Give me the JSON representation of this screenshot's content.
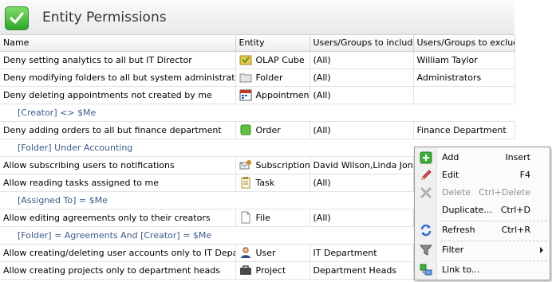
{
  "header": {
    "title": "Entity Permissions"
  },
  "columns": [
    "Name",
    "Entity",
    "Users/Groups to include",
    "Users/Groups to exclude"
  ],
  "rows": [
    {
      "type": "rule",
      "name": "Deny setting analytics to all but IT Director",
      "entity": "OLAP Cube",
      "icon": "olap-cube-icon",
      "include": "(All)",
      "exclude": "William Taylor"
    },
    {
      "type": "rule",
      "name": "Deny modifying folders to all but system administrators",
      "entity": "Folder",
      "icon": "folder-icon",
      "include": "(All)",
      "exclude": "Administrators"
    },
    {
      "type": "rule",
      "name": "Deny deleting appointments not created by me",
      "entity": "Appointment",
      "icon": "appointment-icon",
      "include": "(All)",
      "exclude": ""
    },
    {
      "type": "criteria",
      "text": "[Creator] <> $Me"
    },
    {
      "type": "rule",
      "name": "Deny adding orders to all but finance department",
      "entity": "Order",
      "icon": "order-icon",
      "include": "(All)",
      "exclude": "Finance Department"
    },
    {
      "type": "criteria",
      "text": "[Folder] Under Accounting"
    },
    {
      "type": "rule",
      "name": "Allow subscribing users to notifications",
      "entity": "Subscription",
      "icon": "subscription-icon",
      "include": "David Wilson,Linda Jones",
      "exclude": ""
    },
    {
      "type": "rule",
      "name": "Allow reading tasks assigned to me",
      "entity": "Task",
      "icon": "task-icon",
      "include": "(All)",
      "exclude": ""
    },
    {
      "type": "criteria",
      "text": "[Assigned To] = $Me"
    },
    {
      "type": "rule",
      "name": "Allow editing agreements only to their creators",
      "entity": "File",
      "icon": "file-icon",
      "include": "(All)",
      "exclude": ""
    },
    {
      "type": "criteria",
      "text": "[Folder] = Agreements And [Creator] = $Me"
    },
    {
      "type": "rule",
      "name": "Allow creating/deleting user accounts only to IT Department",
      "entity": "User",
      "icon": "user-icon",
      "include": "IT Department",
      "exclude": ""
    },
    {
      "type": "rule",
      "name": "Allow creating projects only to department heads",
      "entity": "Project",
      "icon": "project-icon",
      "include": "Department Heads",
      "exclude": ""
    }
  ],
  "context_menu": {
    "items": [
      {
        "label": "Add",
        "shortcut": "Insert",
        "icon": "add-icon",
        "disabled": false
      },
      {
        "label": "Edit",
        "shortcut": "F4",
        "icon": "edit-icon",
        "disabled": false
      },
      {
        "label": "Delete",
        "shortcut": "Ctrl+Delete",
        "icon": "delete-icon",
        "disabled": true
      },
      {
        "label": "Duplicate...",
        "shortcut": "Ctrl+D",
        "icon": "",
        "disabled": false
      },
      {
        "label": "Refresh",
        "shortcut": "Ctrl+R",
        "icon": "refresh-icon",
        "disabled": false
      },
      {
        "label": "Filter",
        "shortcut": "",
        "icon": "filter-icon",
        "disabled": false
      },
      {
        "label": "Link to...",
        "shortcut": "",
        "icon": "link-icon",
        "disabled": false
      }
    ]
  }
}
